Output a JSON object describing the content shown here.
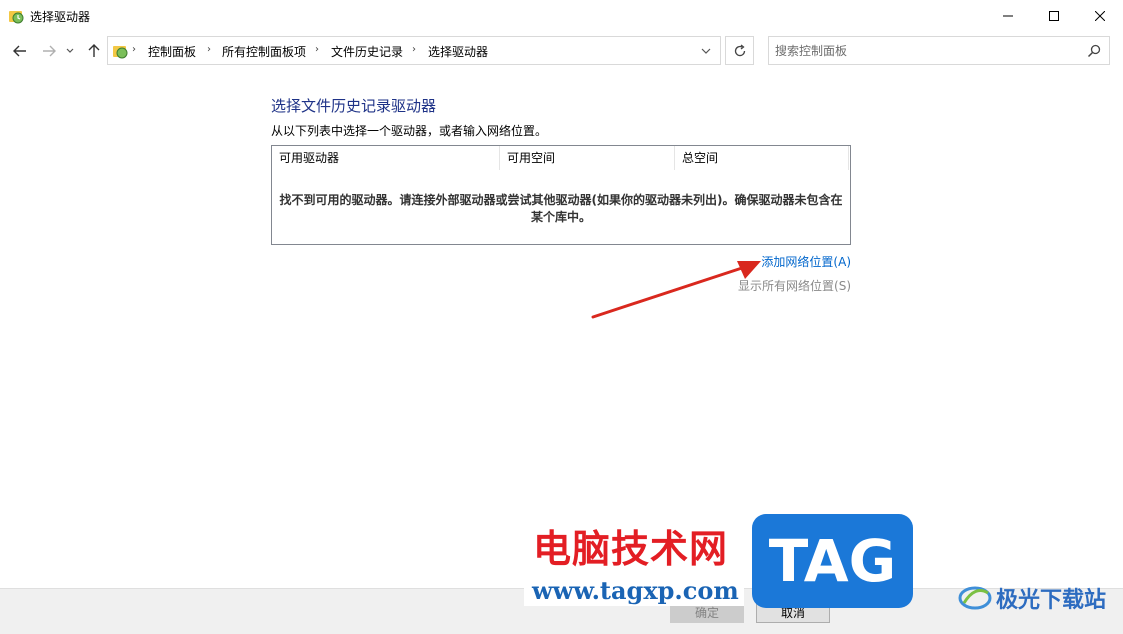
{
  "window": {
    "title": "选择驱动器"
  },
  "nav": {
    "breadcrumbs": [
      "控制面板",
      "所有控制面板项",
      "文件历史记录",
      "选择驱动器"
    ],
    "search_placeholder": "搜索控制面板"
  },
  "content": {
    "heading": "选择文件历史记录驱动器",
    "instruction": "从以下列表中选择一个驱动器，或者输入网络位置。",
    "columns": [
      "可用驱动器",
      "可用空间",
      "总空间"
    ],
    "empty_message": "找不到可用的驱动器。请连接外部驱动器或尝试其他驱动器(如果你的驱动器未列出)。确保驱动器未包含在某个库中。",
    "add_network_link": "添加网络位置(A)",
    "show_network_link": "显示所有网络位置(S)"
  },
  "footer": {
    "ok_label": "确定",
    "cancel_label": "取消"
  },
  "watermark": {
    "cn_text": "电脑技术网",
    "url": "www.tagxp.com",
    "tag": "TAG",
    "site2": "极光下载站"
  },
  "colors": {
    "heading": "#1e3287",
    "link": "#0066cc",
    "arrow": "#d9281e",
    "tag_bg": "#1b78d8"
  }
}
